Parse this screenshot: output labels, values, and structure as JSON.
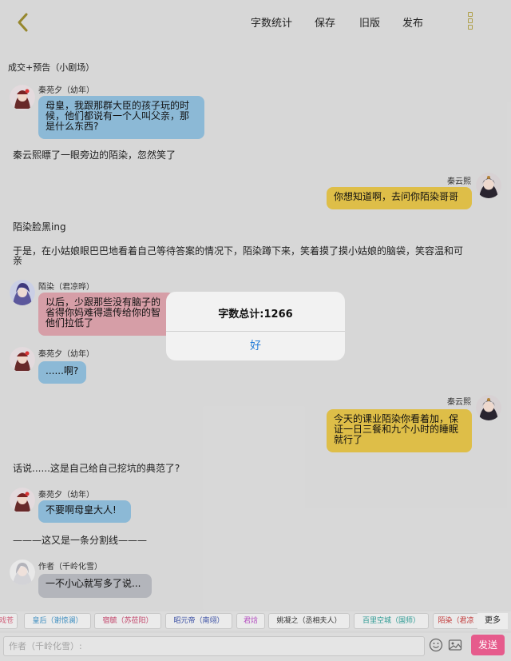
{
  "header": {
    "actions": [
      "字数统计",
      "保存",
      "旧版",
      "发布"
    ]
  },
  "story": {
    "title": "成交+预告（小剧场）"
  },
  "messages": [
    {
      "speaker": "秦苑夕（幼年）",
      "lines": [
        "母皇，我跟那群大臣的孩子玩的时",
        "候，他们都说有一个人叫父亲，那",
        "是什么东西?"
      ]
    },
    {
      "narration": "秦云熙瞟了一眼旁边的陌染，忽然笑了"
    },
    {
      "speaker": "秦云熙",
      "lines": [
        "你想知道啊，去问你陌染哥哥"
      ]
    },
    {
      "narration": "陌染脸黑ing"
    },
    {
      "narration_lines": [
        "于是，在小姑娘眼巴巴地看着自己等待答案的情况下，陌染蹲下来，笑着摸了摸小姑娘的脑袋，笑容温和可",
        "亲"
      ]
    },
    {
      "speaker": "陌染（君凉晔）",
      "lines": [
        "以后，少跟那些没有脑子的",
        "省得你妈难得遗传给你的智",
        "他们拉低了"
      ]
    },
    {
      "speaker": "秦苑夕（幼年）",
      "lines": [
        "......啊?"
      ]
    },
    {
      "speaker": "秦云熙",
      "lines": [
        "今天的课业陌染你看着加，保",
        "证一日三餐和九个小时的睡眠",
        "就行了"
      ]
    },
    {
      "narration": "话说......这是自己给自己挖坑的典范了?"
    },
    {
      "speaker": "秦苑夕（幼年）",
      "lines": [
        "不要啊母皇大人!"
      ]
    },
    {
      "narration": "———这又是一条分割线———"
    },
    {
      "speaker": "作者（千岭化雪）",
      "lines": [
        "一不小心就写多了说..."
      ]
    }
  ],
  "dialog": {
    "title": "字数总计:1266",
    "ok": "好"
  },
  "characters": [
    {
      "label": "戏苍",
      "color": "#d0607a"
    },
    {
      "label": "皇后（谢惊澜）",
      "color": "#3f8fc0"
    },
    {
      "label": "宿毓（苏莅阳）",
      "color": "#c2466b"
    },
    {
      "label": "昭元帝（南翊）",
      "color": "#3a4fa3"
    },
    {
      "label": "君焓",
      "color": "#b44fc0"
    },
    {
      "label": "姚凝之（丞相夫人）",
      "color": "#333333"
    },
    {
      "label": "百里空城（国师）",
      "color": "#2c9a93"
    },
    {
      "label": "陌染（君凉",
      "color": "#c23b3b"
    }
  ],
  "more_label": "更多",
  "composer": {
    "placeholder": "作者（千岭化雪）:",
    "send": "发送"
  }
}
